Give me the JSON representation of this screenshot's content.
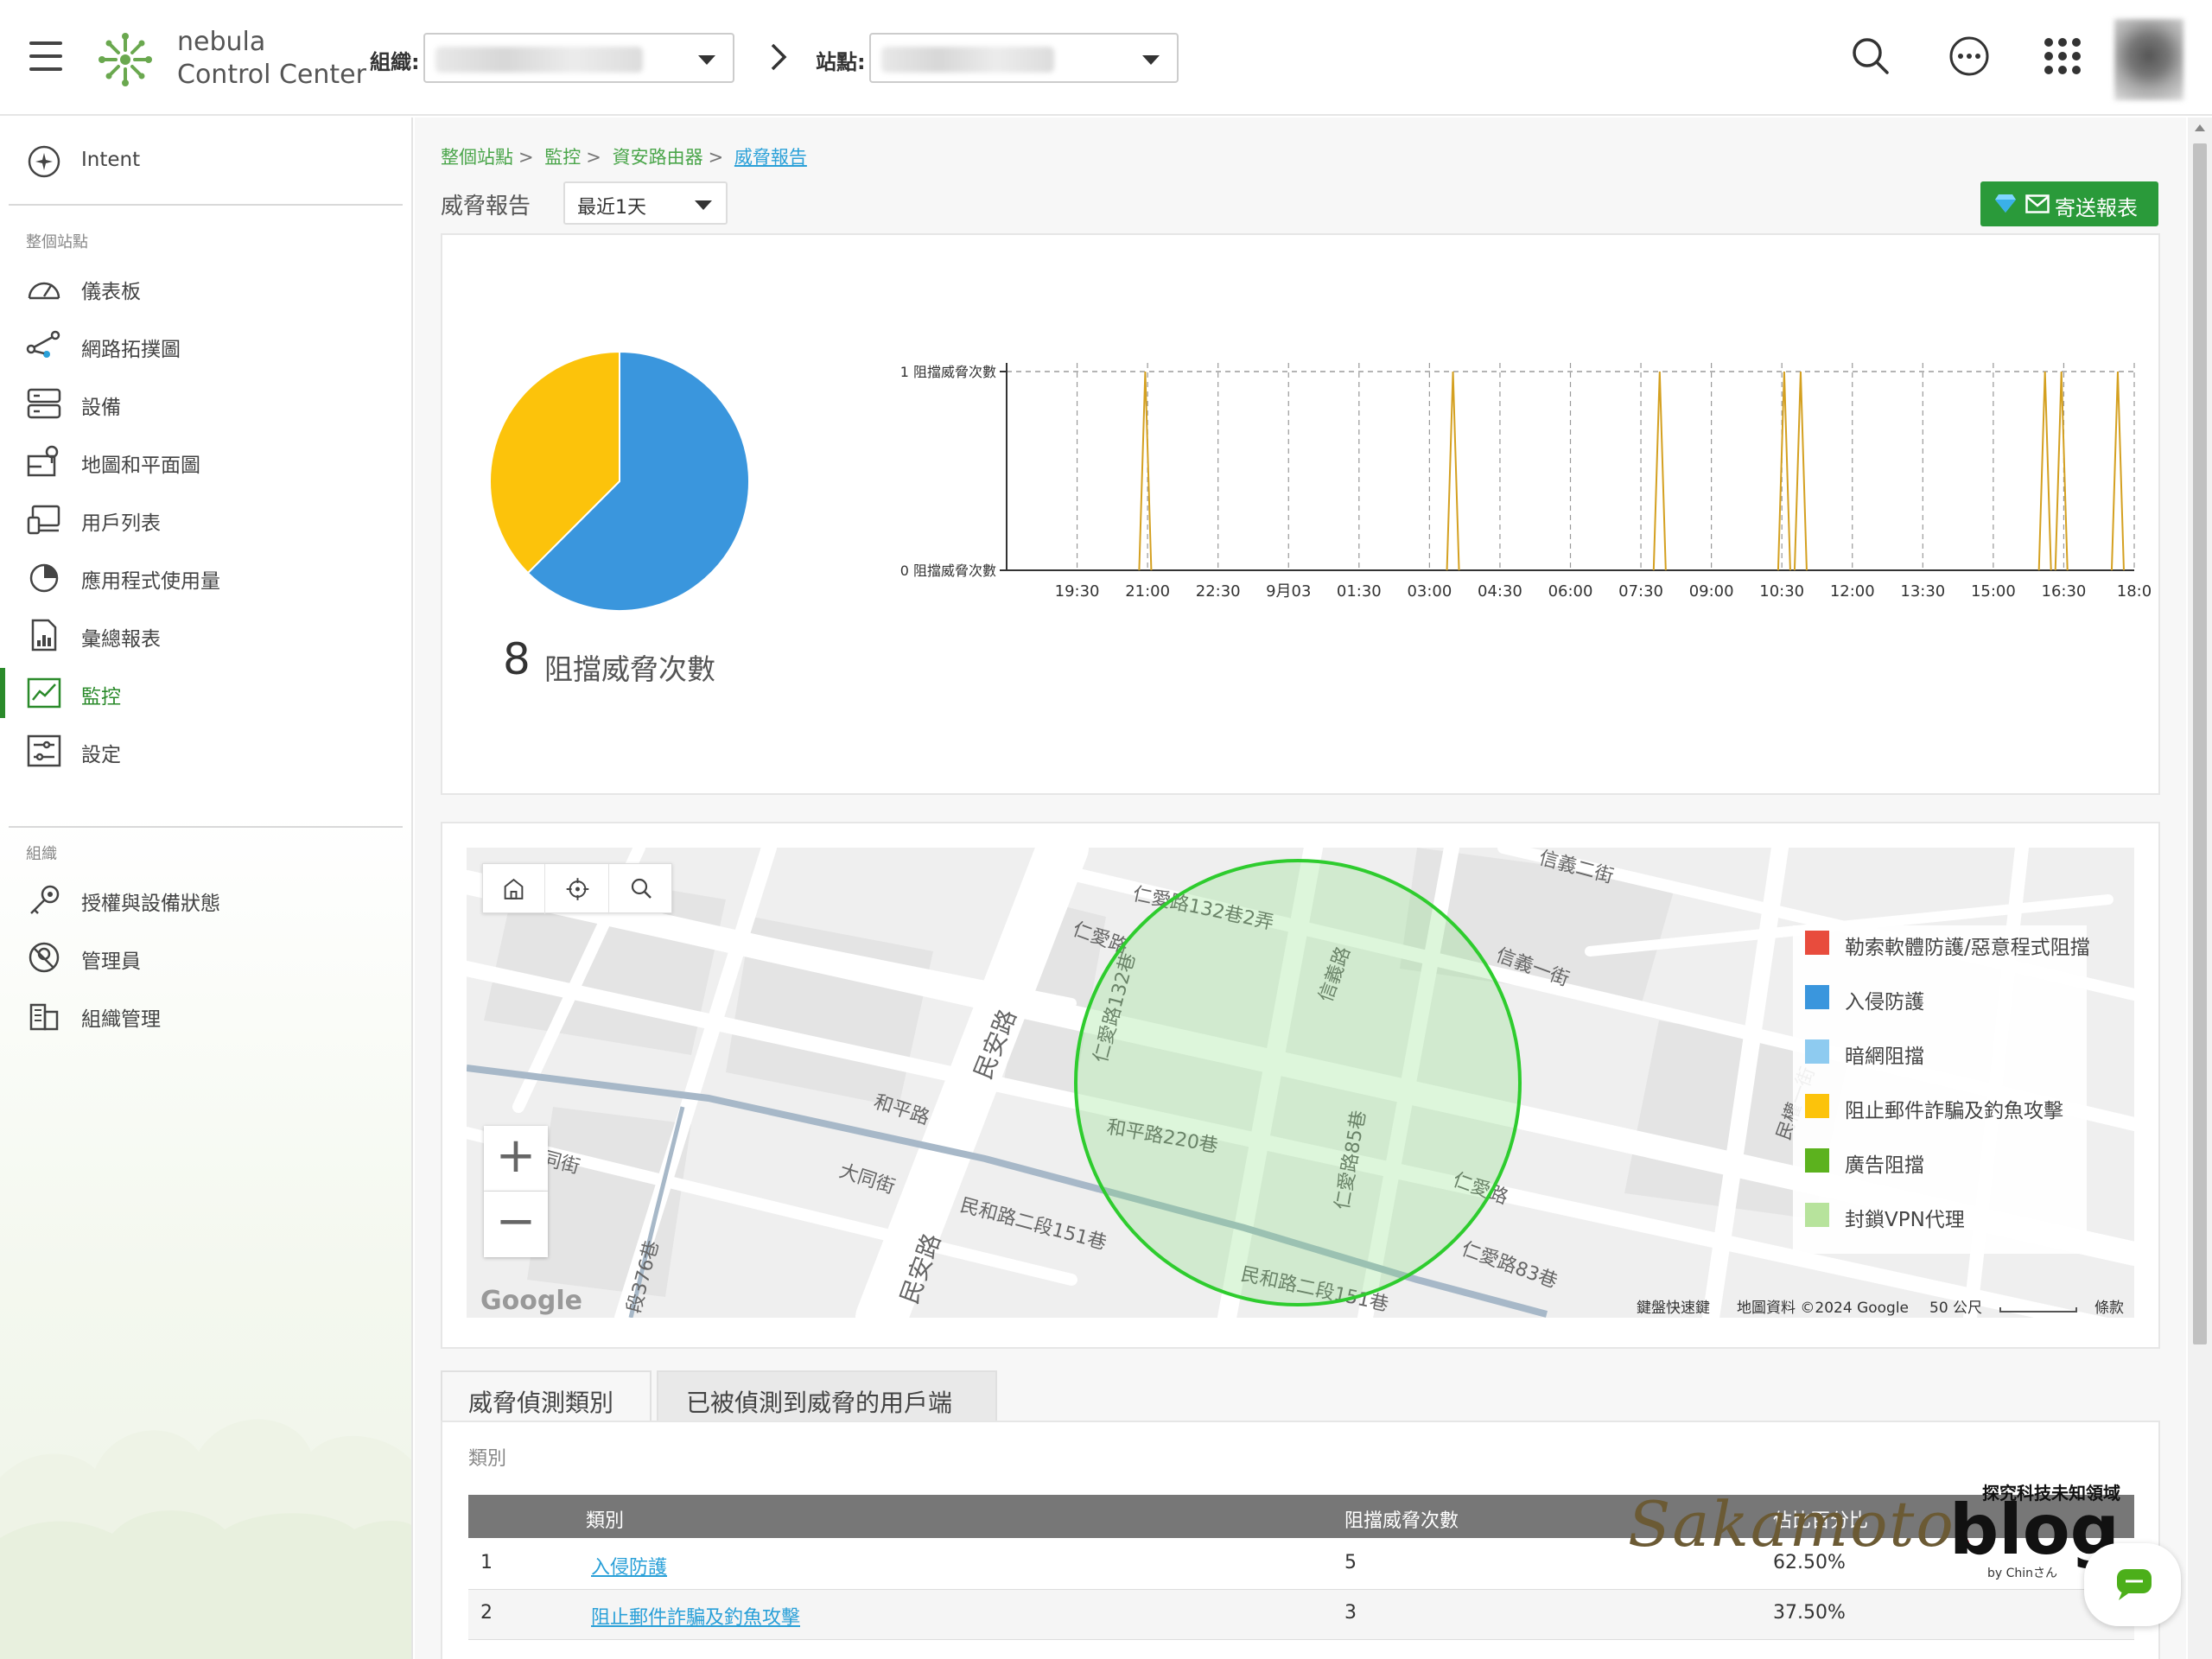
{
  "header": {
    "logo_line1": "nebula",
    "logo_line2": "Control Center",
    "org_label": "組織:",
    "site_label": "站點:"
  },
  "sidebar": {
    "intent_label": "Intent",
    "section_site": "整個站點",
    "section_org": "組織",
    "site_items": [
      {
        "label": "儀表板",
        "icon": "dashboard-icon"
      },
      {
        "label": "網路拓撲圖",
        "icon": "topology-icon"
      },
      {
        "label": "設備",
        "icon": "devices-icon"
      },
      {
        "label": "地圖和平面圖",
        "icon": "map-icon"
      },
      {
        "label": "用戶列表",
        "icon": "clients-icon"
      },
      {
        "label": "應用程式使用量",
        "icon": "app-usage-icon"
      },
      {
        "label": "彙總報表",
        "icon": "report-icon"
      },
      {
        "label": "監控",
        "icon": "monitor-icon",
        "active": true
      },
      {
        "label": "設定",
        "icon": "settings-icon"
      }
    ],
    "org_items": [
      {
        "label": "授權與設備狀態",
        "icon": "license-icon"
      },
      {
        "label": "管理員",
        "icon": "admin-icon"
      },
      {
        "label": "組織管理",
        "icon": "org-manage-icon"
      }
    ]
  },
  "breadcrumb": {
    "items": [
      "整個站點",
      "監控",
      "資安路由器"
    ],
    "separator": ">",
    "current": "威脅報告"
  },
  "page": {
    "title": "威脅報告",
    "range_value": "最近1天",
    "send_button": "寄送報表"
  },
  "summary": {
    "total": "8",
    "total_label": "阻擋威脅次數"
  },
  "chart_data": [
    {
      "type": "pie",
      "slices": [
        {
          "label": "入侵防護",
          "value": 5,
          "color": "#3a96dd"
        },
        {
          "label": "阻止郵件詐騙及釣魚攻擊",
          "value": 3,
          "color": "#fcc30b"
        }
      ]
    },
    {
      "type": "line",
      "x_ticks": [
        "19:30",
        "21:00",
        "22:30",
        "9月03",
        "01:30",
        "03:00",
        "04:30",
        "06:00",
        "07:30",
        "09:00",
        "10:30",
        "12:00",
        "13:30",
        "15:00",
        "16:30",
        "18:0"
      ],
      "y_ticks": [
        "0 阻擋威脅次數",
        "1 阻擋威脅次數"
      ],
      "ylim": [
        0,
        1
      ],
      "xlim_hours": [
        18.0,
        42.0
      ],
      "series": [
        {
          "color": "#d4a020",
          "spikes_at_hours": [
            20.95,
            27.5,
            31.9,
            34.55,
            34.9,
            40.1,
            40.45,
            41.65
          ],
          "value": 1
        }
      ]
    }
  ],
  "map": {
    "legend": [
      {
        "label": "勒索軟體防護/惡意程式阻擋",
        "color": "#e84c3d"
      },
      {
        "label": "入侵防護",
        "color": "#3a96dd"
      },
      {
        "label": "暗網阻擋",
        "color": "#8ecbf0"
      },
      {
        "label": "阻止郵件詐騙及釣魚攻擊",
        "color": "#fcc30b"
      },
      {
        "label": "廣告阻擋",
        "color": "#5cb21e"
      },
      {
        "label": "封鎖VPN代理",
        "color": "#b7e39c"
      }
    ],
    "streets": [
      "仁愛路132巷2弄",
      "信義二街",
      "信義一街",
      "仁愛路",
      "民安路",
      "和平路",
      "和平路220巷",
      "大同街",
      "民和路二段151巷",
      "信義路",
      "仁愛路85巷",
      "仁愛路83巷",
      "民權一街",
      "段376巷",
      "仁愛路132巷"
    ],
    "google_logo": "Google",
    "footer": {
      "shortcuts": "鍵盤快速鍵",
      "data": "地圖資料 ©2024 Google",
      "scale": "50 公尺",
      "terms": "條款"
    }
  },
  "tabs": [
    "威脅偵測類別",
    "已被偵測到威脅的用戶端"
  ],
  "table": {
    "caption": "類別",
    "columns": [
      "類別",
      "阻擋威脅次數",
      "佔比百分比"
    ],
    "rows": [
      {
        "idx": "1",
        "category": "入侵防護",
        "count": "5",
        "pct": "62.50%"
      },
      {
        "idx": "2",
        "category": "阻止郵件詐騙及釣魚攻擊",
        "count": "3",
        "pct": "37.50%"
      }
    ]
  },
  "watermark": {
    "main": "Sakamoto",
    "dot": ".",
    "blog": "blog",
    "tag": "探究科技未知領域",
    "by": "by Chinさん"
  }
}
